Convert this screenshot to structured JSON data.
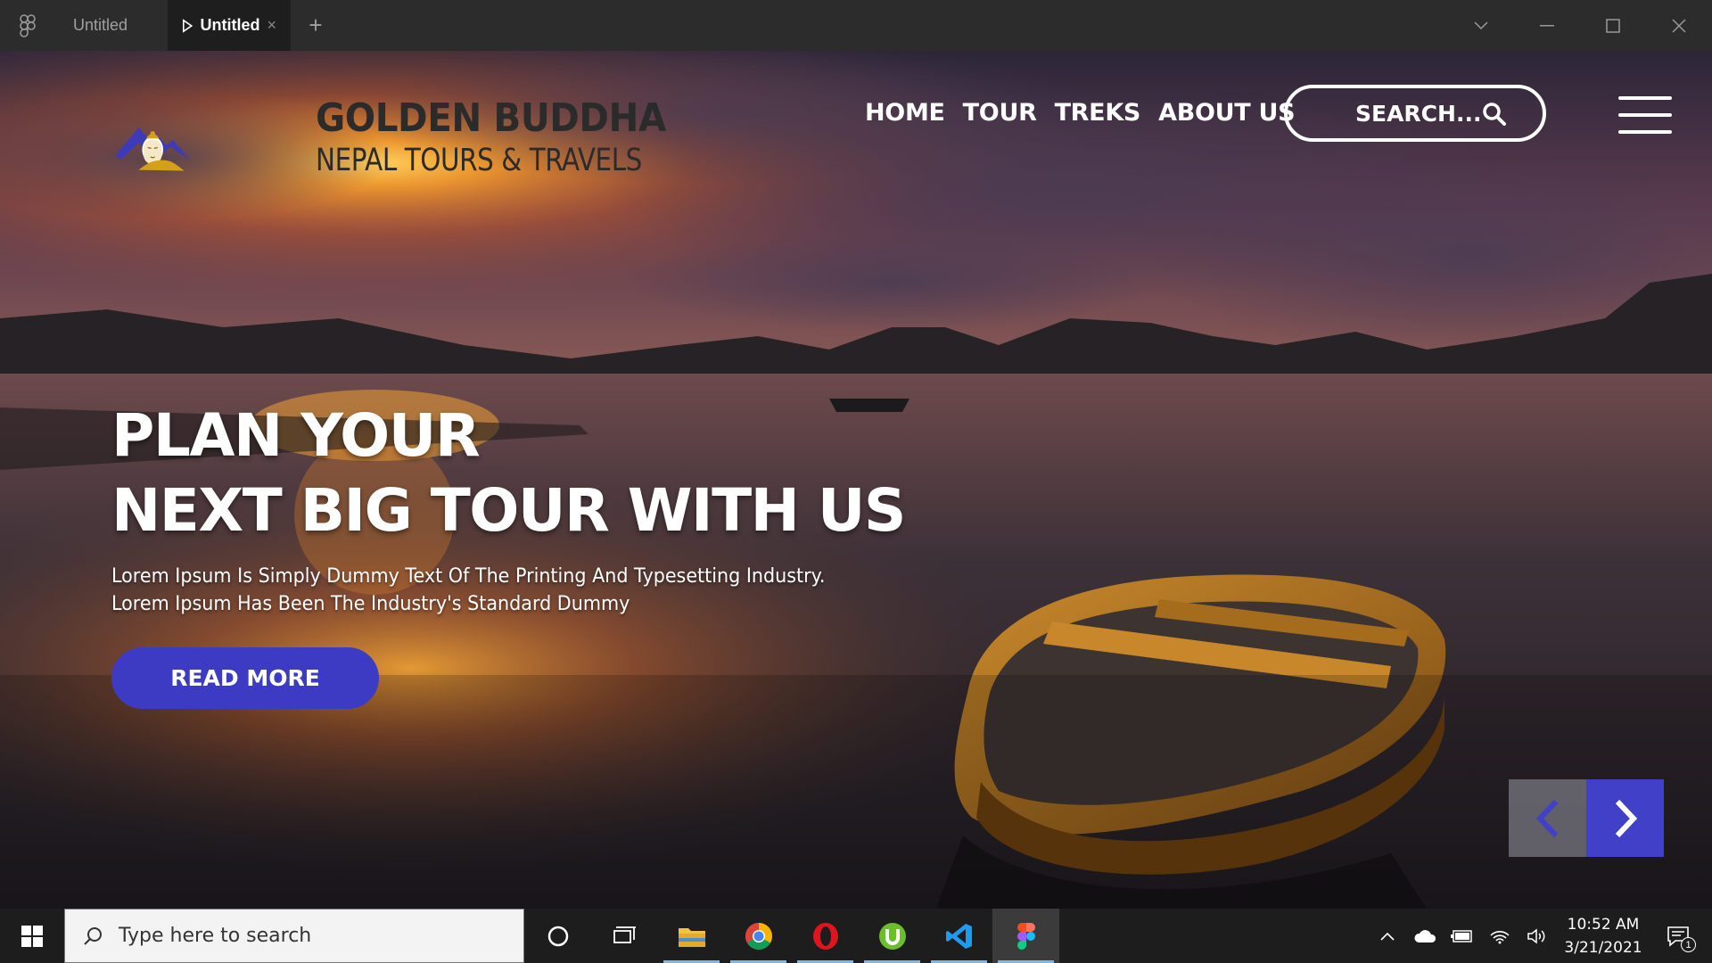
{
  "titlebar": {
    "tabs": [
      {
        "label": "Untitled",
        "active": false
      },
      {
        "label": "Untitled",
        "active": true
      }
    ],
    "close_glyph": "×",
    "new_tab_glyph": "+"
  },
  "site": {
    "brand": {
      "name": "GOLDEN BUDDHA",
      "tagline": "NEPAL TOURS & TRAVELS"
    },
    "nav": [
      "HOME",
      "TOUR",
      "TREKS",
      "ABOUT US"
    ],
    "search_label": "SEARCH...",
    "hero": {
      "headline_line1": "PLAN YOUR",
      "headline_line2": "NEXT BIG TOUR WITH US",
      "lead_line1": "Lorem Ipsum Is Simply Dummy Text Of The Printing And Typesetting Industry.",
      "lead_line2": "Lorem Ipsum Has Been The Industry's Standard Dummy",
      "cta": "READ MORE"
    },
    "colors": {
      "accent": "#3d3bc4",
      "logo_gold": "#d4a017",
      "logo_blue": "#3e3bb8"
    }
  },
  "taskbar": {
    "search_placeholder": "Type here to search",
    "pinned": [
      "cortana-icon",
      "task-view-icon",
      "file-explorer-icon",
      "chrome-icon",
      "opera-icon",
      "utorrent-icon",
      "vscode-icon",
      "figma-icon"
    ],
    "time": "10:52 AM",
    "date": "3/21/2021",
    "notification_count": "1"
  }
}
